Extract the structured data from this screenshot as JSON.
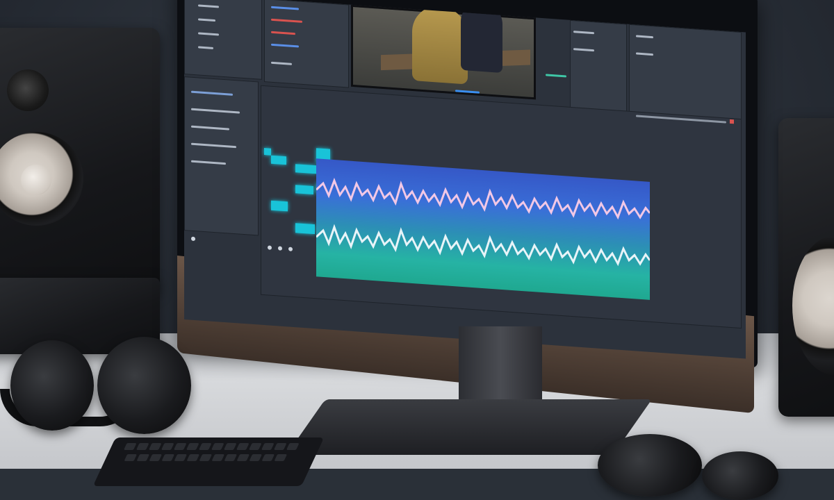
{
  "scene": {
    "description_tags": [
      "speakers",
      "monitor",
      "timeline",
      "waveform",
      "headphones",
      "keyboard"
    ],
    "colors": {
      "accent_cyan": "#19c3d8",
      "wave_blue": "#3a6fd8",
      "wave_teal": "#26b3a4",
      "ui_panel": "#353c47",
      "desk": "#d7d9dc"
    }
  },
  "icons": {
    "speaker_left": "speaker-icon",
    "speaker_right": "speaker-icon",
    "headphones": "headphones-icon",
    "keyboard": "keyboard-icon"
  }
}
